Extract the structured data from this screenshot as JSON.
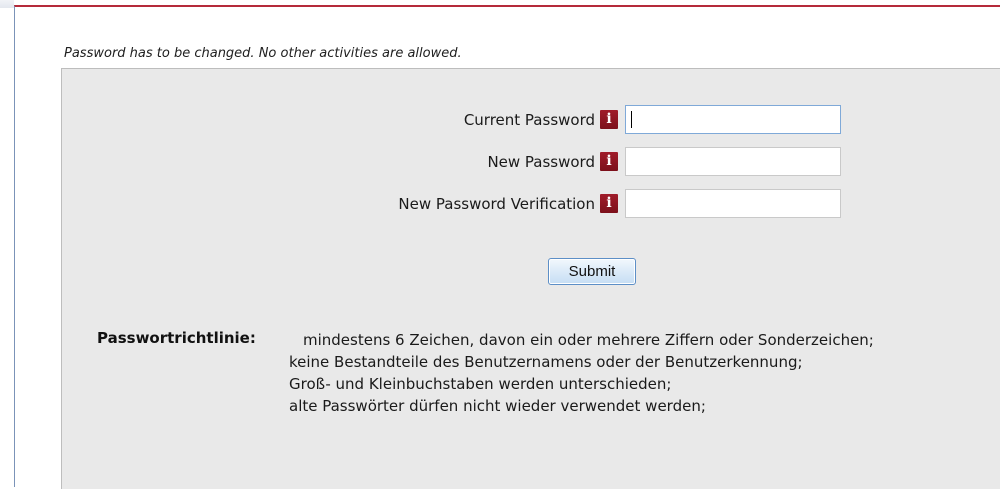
{
  "notice": "Password has to be changed. No other activities are allowed.",
  "form": {
    "fields": [
      {
        "label": "Current Password",
        "value": "",
        "info_icon": "info-icon"
      },
      {
        "label": "New Password",
        "value": "",
        "info_icon": "info-icon"
      },
      {
        "label": "New Password Verification",
        "value": "",
        "info_icon": "info-icon"
      }
    ],
    "info_glyph": "i",
    "submit_label": "Submit"
  },
  "policy": {
    "title": "Passwortrichtlinie:",
    "lines": [
      "mindestens 6 Zeichen, davon ein oder mehrere Ziffern oder Sonderzeichen;",
      "keine Bestandteile des Benutzernamens oder der Benutzerkennung;",
      "Groß- und Kleinbuchstaben werden unterschieden;",
      "alte Passwörter dürfen nicht wieder verwendet werden;"
    ]
  },
  "colors": {
    "accent_border": "#b52a3a",
    "info_icon_bg": "#8f1623",
    "panel_bg": "#e9e9e9",
    "button_border": "#5d8fc7"
  }
}
